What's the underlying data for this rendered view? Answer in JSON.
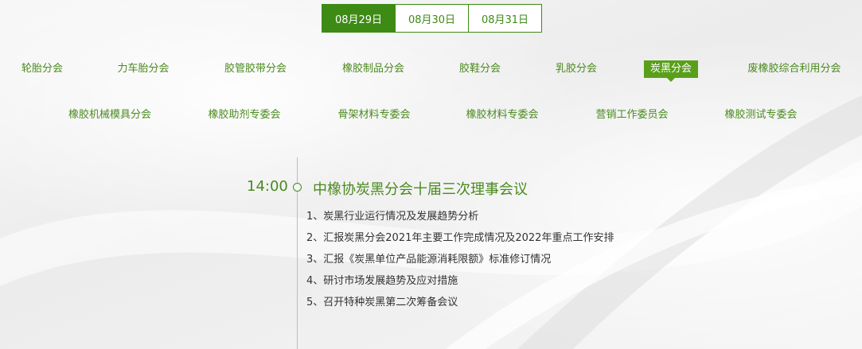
{
  "dates": [
    {
      "label": "08月29日",
      "active": true
    },
    {
      "label": "08月30日",
      "active": false
    },
    {
      "label": "08月31日",
      "active": false
    }
  ],
  "branches_row1": [
    {
      "label": "轮胎分会"
    },
    {
      "label": "力车胎分会"
    },
    {
      "label": "胶管胶带分会"
    },
    {
      "label": "橡胶制品分会"
    },
    {
      "label": "胶鞋分会"
    },
    {
      "label": "乳胶分会"
    },
    {
      "label": "炭黑分会",
      "active": true
    },
    {
      "label": "废橡胶综合利用分会"
    }
  ],
  "branches_row2": [
    {
      "label": "橡胶机械模具分会"
    },
    {
      "label": "橡胶助剂专委会"
    },
    {
      "label": "骨架材料专委会"
    },
    {
      "label": "橡胶材料专委会"
    },
    {
      "label": "营销工作委员会"
    },
    {
      "label": "橡胶测试专委会"
    }
  ],
  "event": {
    "time": "14:00",
    "title": "中橡协炭黑分会十届三次理事会议",
    "agenda": [
      "1、炭黑行业运行情况及发展趋势分析",
      "2、汇报炭黑分会2021年主要工作完成情况及2022年重点工作安排",
      "3、汇报《炭黑单位产品能源消耗限额》标准修订情况",
      "4、研讨市场发展趋势及应对措施",
      "5、召开特种炭黑第二次筹备会议"
    ]
  },
  "colors": {
    "accent": "#3d8a15",
    "text_green": "#4a8a1e"
  }
}
